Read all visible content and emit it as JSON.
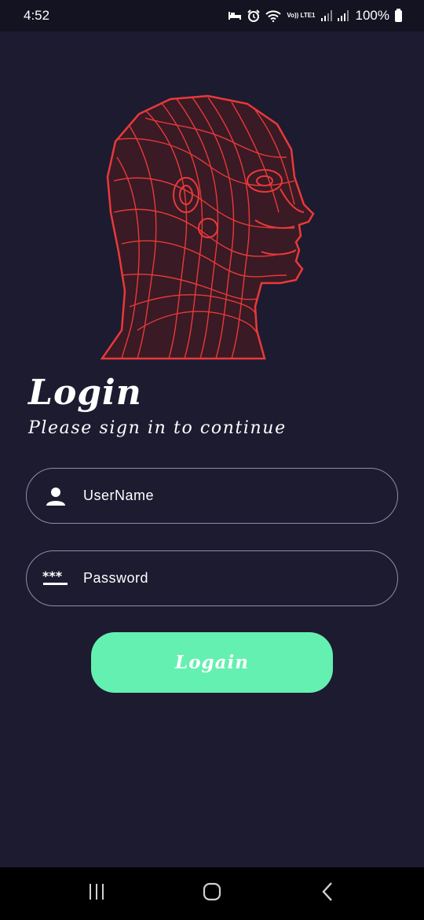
{
  "status_bar": {
    "time": "4:52",
    "network_label": "Vo)) LTE1",
    "battery": "100%"
  },
  "hero": {
    "icon": "anatomy-head-illustration"
  },
  "login": {
    "title": "Login",
    "subtitle": "Please sign in to continue",
    "username_placeholder": "UserName",
    "password_placeholder": "Password",
    "button_label": "Logain"
  },
  "colors": {
    "background": "#1c1b30",
    "accent": "#64f0b0",
    "illustration": "#e8393a",
    "field_border": "#8e8ea4"
  },
  "nav_bar": {
    "icons": [
      "recents-icon",
      "home-icon",
      "back-icon"
    ]
  }
}
